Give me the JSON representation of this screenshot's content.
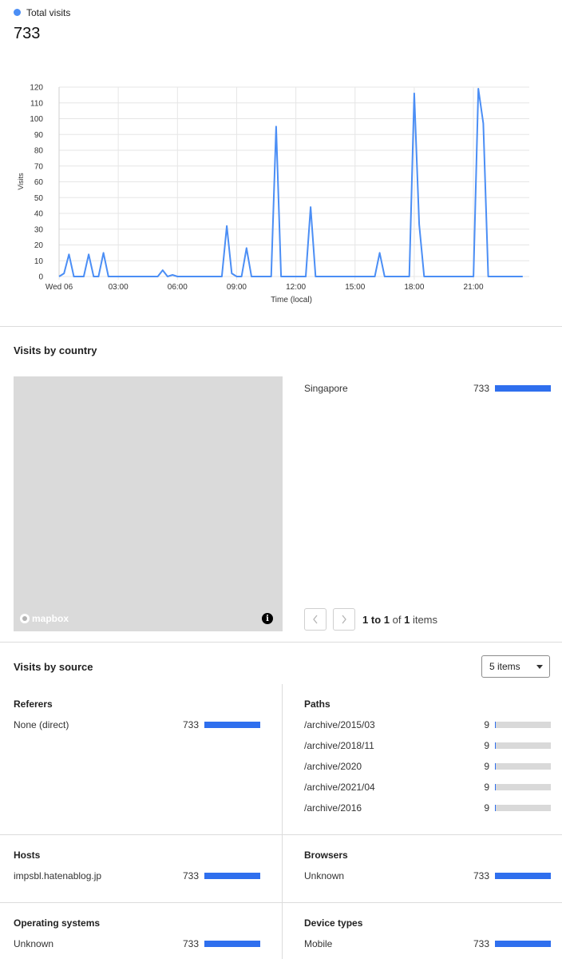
{
  "summary": {
    "legend_label": "Total visits",
    "total": "733",
    "legend_color": "#4b8ef5"
  },
  "chart_data": {
    "type": "line",
    "xlabel": "Time (local)",
    "ylabel": "Visits",
    "ylim": [
      0,
      120
    ],
    "y_ticks": [
      "0",
      "10",
      "20",
      "30",
      "40",
      "50",
      "60",
      "70",
      "80",
      "90",
      "100",
      "110",
      "120"
    ],
    "x_tick_labels": [
      "Wed 06",
      "03:00",
      "06:00",
      "09:00",
      "12:00",
      "15:00",
      "18:00",
      "21:00"
    ],
    "grid": true,
    "series": [
      {
        "color": "#4b8ef5",
        "x": [
          0.0,
          0.25,
          0.5,
          0.75,
          1.0,
          1.25,
          1.5,
          1.75,
          2.0,
          2.25,
          2.5,
          2.75,
          3.0,
          3.25,
          3.5,
          3.75,
          4.0,
          4.25,
          4.5,
          4.75,
          5.0,
          5.25,
          5.5,
          5.75,
          6.0,
          6.25,
          6.5,
          6.75,
          7.0,
          7.25,
          7.5,
          7.75,
          8.0,
          8.25,
          8.5,
          8.75,
          9.0,
          9.25,
          9.5,
          9.75,
          10.0,
          10.25,
          10.5,
          10.75,
          11.0,
          11.25,
          11.5,
          11.75,
          12.0,
          12.25,
          12.5,
          12.75,
          13.0,
          13.25,
          13.5,
          13.75,
          14.0,
          14.25,
          14.5,
          14.75,
          15.0,
          15.25,
          15.5,
          15.75,
          16.0,
          16.25,
          16.5,
          16.75,
          17.0,
          17.25,
          17.5,
          17.75,
          18.0,
          18.25,
          18.5,
          18.75,
          19.0,
          19.25,
          19.5,
          19.75,
          20.0,
          20.25,
          20.5,
          20.75,
          21.0,
          21.25,
          21.5,
          21.75,
          22.0,
          22.25,
          22.5,
          22.75,
          23.0,
          23.25,
          23.5
        ],
        "y": [
          0,
          2,
          14,
          0,
          0,
          0,
          14,
          0,
          0,
          15,
          0,
          0,
          0,
          0,
          0,
          0,
          0,
          0,
          0,
          0,
          0,
          4,
          0,
          1,
          0,
          0,
          0,
          0,
          0,
          0,
          0,
          0,
          0,
          0,
          32,
          2,
          0,
          0,
          18,
          0,
          0,
          0,
          0,
          0,
          95,
          0,
          0,
          0,
          0,
          0,
          0,
          44,
          0,
          0,
          0,
          0,
          0,
          0,
          0,
          0,
          0,
          0,
          0,
          0,
          0,
          15,
          0,
          0,
          0,
          0,
          0,
          0,
          116,
          33,
          0,
          0,
          0,
          0,
          0,
          0,
          0,
          0,
          0,
          0,
          0,
          119,
          97,
          0,
          0,
          0,
          0,
          0,
          0,
          0,
          0
        ]
      }
    ]
  },
  "country": {
    "title": "Visits by country",
    "rows": [
      {
        "label": "Singapore",
        "count": "733",
        "fraction": 1.0
      }
    ],
    "map_logo": "mapbox",
    "info_glyph": "i",
    "pagination": {
      "from": "1",
      "to_word": "to",
      "to": "1",
      "of_word": "of",
      "total": "1",
      "items_word": "items"
    }
  },
  "sources": {
    "title": "Visits by source",
    "items_select": "5 items",
    "referers": {
      "title": "Referers",
      "rows": [
        {
          "label": "None (direct)",
          "count": "733",
          "fraction": 1.0
        }
      ]
    },
    "paths": {
      "title": "Paths",
      "rows": [
        {
          "label": "/archive/2015/03",
          "count": "9",
          "fraction": 0.0123
        },
        {
          "label": "/archive/2018/11",
          "count": "9",
          "fraction": 0.0123
        },
        {
          "label": "/archive/2020",
          "count": "9",
          "fraction": 0.0123
        },
        {
          "label": "/archive/2021/04",
          "count": "9",
          "fraction": 0.0123
        },
        {
          "label": "/archive/2016",
          "count": "9",
          "fraction": 0.0123
        }
      ]
    },
    "hosts": {
      "title": "Hosts",
      "rows": [
        {
          "label": "impsbl.hatenablog.jp",
          "count": "733",
          "fraction": 1.0
        }
      ]
    },
    "browsers": {
      "title": "Browsers",
      "rows": [
        {
          "label": "Unknown",
          "count": "733",
          "fraction": 1.0
        }
      ]
    },
    "os": {
      "title": "Operating systems",
      "rows": [
        {
          "label": "Unknown",
          "count": "733",
          "fraction": 1.0
        }
      ]
    },
    "devices": {
      "title": "Device types",
      "rows": [
        {
          "label": "Mobile",
          "count": "733",
          "fraction": 1.0
        }
      ]
    }
  }
}
